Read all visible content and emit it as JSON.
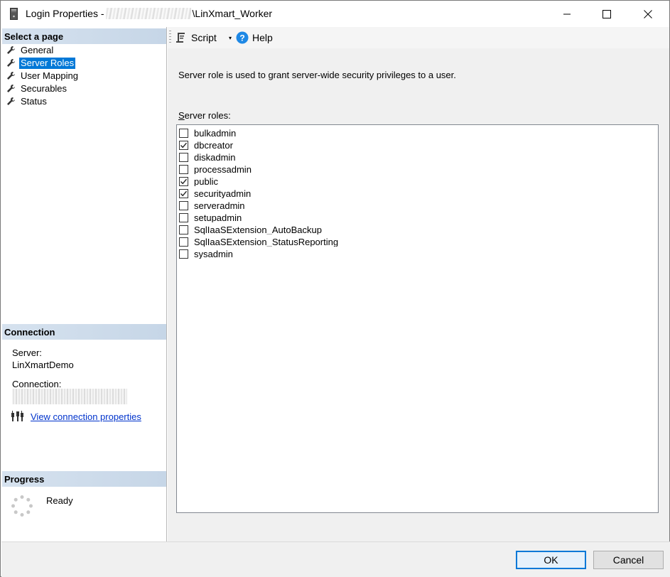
{
  "window": {
    "title_prefix": "Login Properties -",
    "title_suffix": "\\LinXmart_Worker",
    "controls": {
      "minimize": "minimize",
      "maximize": "maximize",
      "close": "close"
    }
  },
  "left": {
    "select_page_header": "Select a page",
    "pages": [
      {
        "label": "General",
        "selected": false
      },
      {
        "label": "Server Roles",
        "selected": true
      },
      {
        "label": "User Mapping",
        "selected": false
      },
      {
        "label": "Securables",
        "selected": false
      },
      {
        "label": "Status",
        "selected": false
      }
    ],
    "connection_header": "Connection",
    "server_label": "Server:",
    "server_value": "LinXmartDemo",
    "connection_label": "Connection:",
    "view_connection_link": "View connection properties",
    "progress_header": "Progress",
    "progress_status": "Ready"
  },
  "toolbar": {
    "script_label": "Script",
    "dropdown_glyph": "▾",
    "help_label": "Help"
  },
  "main": {
    "description": "Server role is used to grant server-wide security privileges to a user.",
    "roles_label_first": "S",
    "roles_label_rest": "erver roles:",
    "roles": [
      {
        "name": "bulkadmin",
        "checked": false
      },
      {
        "name": "dbcreator",
        "checked": true
      },
      {
        "name": "diskadmin",
        "checked": false
      },
      {
        "name": "processadmin",
        "checked": false
      },
      {
        "name": "public",
        "checked": true
      },
      {
        "name": "securityadmin",
        "checked": true
      },
      {
        "name": "serveradmin",
        "checked": false
      },
      {
        "name": "setupadmin",
        "checked": false
      },
      {
        "name": "SqlIaaSExtension_AutoBackup",
        "checked": false
      },
      {
        "name": "SqlIaaSExtension_StatusReporting",
        "checked": false
      },
      {
        "name": "sysadmin",
        "checked": false
      }
    ]
  },
  "buttons": {
    "ok": "OK",
    "cancel": "Cancel"
  },
  "colors": {
    "selection": "#0078d7",
    "link": "#0033cc",
    "section_header": "#c6d6e7",
    "panel_bg": "#f0f0f0"
  }
}
